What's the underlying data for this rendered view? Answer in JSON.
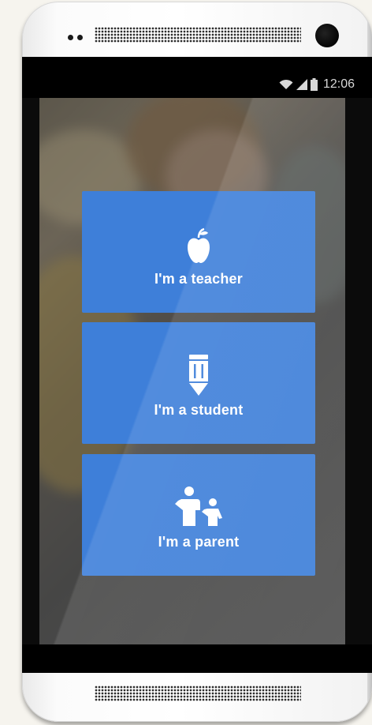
{
  "status_bar": {
    "time": "12:06",
    "icons": [
      "wifi-icon",
      "signal-icon",
      "battery-icon"
    ]
  },
  "roles": [
    {
      "label": "I'm a teacher",
      "icon": "apple-icon"
    },
    {
      "label": "I'm a student",
      "icon": "pencil-icon"
    },
    {
      "label": "I'm a parent",
      "icon": "parent-child-icon"
    }
  ],
  "colors": {
    "card_blue": "#3e7fd9",
    "status_bar": "#000000"
  }
}
